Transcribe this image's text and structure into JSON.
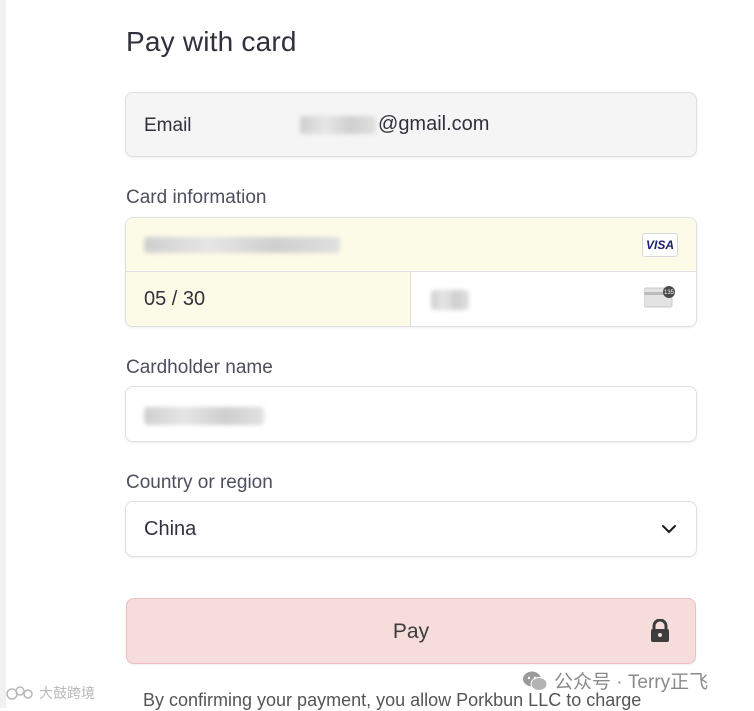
{
  "page": {
    "title": "Pay with card"
  },
  "email": {
    "label": "Email",
    "value_suffix": "gmail.com",
    "value_at": "@"
  },
  "card": {
    "section_label": "Card information",
    "brand": "VISA",
    "expiry": "05 / 30",
    "cvc_icon_text": "135"
  },
  "cardholder": {
    "section_label": "Cardholder name"
  },
  "country": {
    "section_label": "Country or region",
    "selected": "China"
  },
  "pay_button": {
    "label": "Pay"
  },
  "footer": {
    "text": "By confirming your payment, you allow Porkbun LLC to charge"
  },
  "watermarks": {
    "right": "公众号 · Terry正飞",
    "left": "大鼓跨境"
  },
  "colors": {
    "autofill_bg": "#fcfbe7",
    "pay_bg": "#f7dcdc",
    "visa_blue": "#1a1f71"
  }
}
